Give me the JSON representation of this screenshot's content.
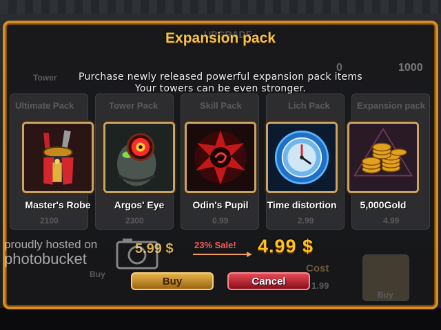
{
  "background": {
    "top_tab": "UPGRADE",
    "tower_tab": "Tower",
    "currency_left": "0",
    "currency_right": "1000",
    "packs": [
      {
        "name": "Ultimate Pack",
        "price": "2100"
      },
      {
        "name": "Tower Pack",
        "price": "2300"
      },
      {
        "name": "Skill Pack",
        "price": "0.99"
      },
      {
        "name": "Lich Pack",
        "price": "2.99"
      },
      {
        "name": "Expansion pack",
        "price": "4.99"
      }
    ],
    "buy_label": "Buy",
    "cost_label": "Cost",
    "cost_value": "1.99",
    "bottom_buy": "Buy"
  },
  "popup": {
    "title": "Expansion pack",
    "description_line1": "Purchase newly released powerful expansion pack items",
    "description_line2": "Your towers can be even stronger."
  },
  "items": [
    {
      "label": "Master's Robe",
      "icon": "robe-icon"
    },
    {
      "label": "Argos' Eye",
      "icon": "eye-icon"
    },
    {
      "label": "Odin's Pupil",
      "icon": "pupil-icon"
    },
    {
      "label": "Time distortion",
      "icon": "clock-icon"
    },
    {
      "label": "5,000Gold",
      "icon": "gold-coins-icon"
    }
  ],
  "pricing": {
    "old_price": "5.99 $",
    "sale_text": "23% Sale!",
    "new_price": "4.99 $"
  },
  "buttons": {
    "buy": "Buy",
    "cancel": "Cancel"
  },
  "watermark": {
    "line1": "proudly hosted on",
    "line2": "photobucket"
  },
  "colors": {
    "frame": "#d98d1f",
    "title": "#f4c44a",
    "price": "#ffc21f",
    "sale": "#ff5a5a",
    "cancel": "#c41d2b",
    "buy": "#c98a24"
  }
}
